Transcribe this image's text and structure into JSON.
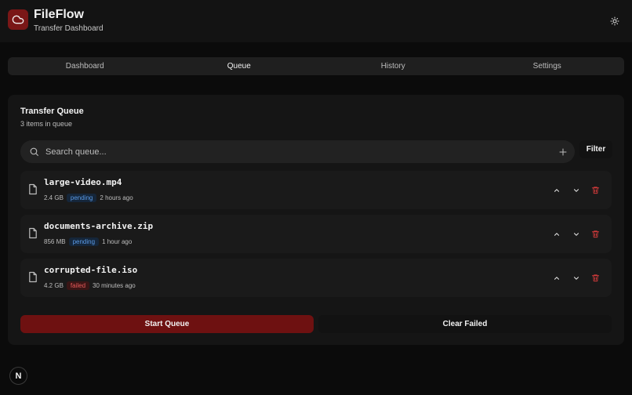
{
  "app": {
    "title": "FileFlow",
    "subtitle": "Transfer Dashboard",
    "logo_icon": "cloud-icon"
  },
  "header": {
    "theme_icon": "sun-icon"
  },
  "tabs": [
    {
      "label": "Dashboard",
      "active": false
    },
    {
      "label": "Queue",
      "active": true
    },
    {
      "label": "History",
      "active": false
    },
    {
      "label": "Settings",
      "active": false
    }
  ],
  "queue": {
    "title": "Transfer Queue",
    "count_text": "3 items in queue",
    "search": {
      "placeholder": "Search queue...",
      "value": ""
    },
    "filter_label": "Filter",
    "items": [
      {
        "name": "large-video.mp4",
        "size": "2.4 GB",
        "status": "pending",
        "time": "2 hours ago"
      },
      {
        "name": "documents-archive.zip",
        "size": "856 MB",
        "status": "pending",
        "time": "1 hour ago"
      },
      {
        "name": "corrupted-file.iso",
        "size": "4.2 GB",
        "status": "failed",
        "time": "30 minutes ago"
      }
    ],
    "start_label": "Start Queue",
    "clear_label": "Clear Failed"
  },
  "corner_badge": "N",
  "colors": {
    "accent": "#7a1717",
    "start_button": "#6e1111",
    "pending": "#5a9ae6",
    "failed": "#e65a5a",
    "delete": "#c0392b"
  }
}
